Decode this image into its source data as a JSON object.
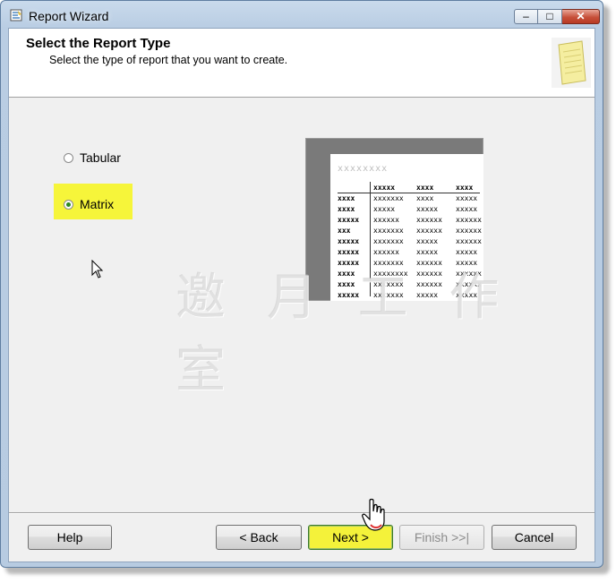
{
  "window": {
    "title": "Report Wizard",
    "controls": {
      "minimize": "–",
      "maximize": "□",
      "close": "✕"
    }
  },
  "header": {
    "title": "Select the Report Type",
    "subtitle": "Select the type of report that you want to create.",
    "icon": "report-page-icon"
  },
  "report_types": [
    {
      "label": "Tabular",
      "selected": false
    },
    {
      "label": "Matrix",
      "selected": true
    }
  ],
  "preview": {
    "title": "xxxxxxxx",
    "header_row": [
      "xxxxx",
      "xxxx",
      "xxxx"
    ],
    "rows": [
      [
        "xxxx",
        "xxxxxxx",
        "xxxx",
        "xxxxx"
      ],
      [
        "xxxx",
        "xxxxx",
        "xxxxx",
        "xxxxx"
      ],
      [
        "xxxxx",
        "xxxxxx",
        "xxxxxx",
        "xxxxxx"
      ],
      [
        "xxx",
        "xxxxxxx",
        "xxxxxx",
        "xxxxxx"
      ],
      [
        "xxxxx",
        "xxxxxxx",
        "xxxxx",
        "xxxxxx"
      ],
      [
        "xxxxx",
        "xxxxxx",
        "xxxxx",
        "xxxxx"
      ],
      [
        "xxxxx",
        "xxxxxxx",
        "xxxxxx",
        "xxxxx"
      ],
      [
        "xxxx",
        "xxxxxxxx",
        "xxxxxx",
        "xxxxxx"
      ],
      [
        "xxxx",
        "xxxxxxx",
        "xxxxxx",
        "xxxxxx"
      ],
      [
        "xxxxx",
        "xxxxxxx",
        "xxxxx",
        "xxxxx"
      ]
    ]
  },
  "watermark": "邀 月 工 作 室",
  "buttons": {
    "help": "Help",
    "back": "< Back",
    "next": "Next >",
    "finish": "Finish >>|",
    "cancel": "Cancel"
  },
  "colors": {
    "highlight": "#f6f53a",
    "titlebar": "#c9daec",
    "dialog_bg": "#f0f0f0"
  }
}
